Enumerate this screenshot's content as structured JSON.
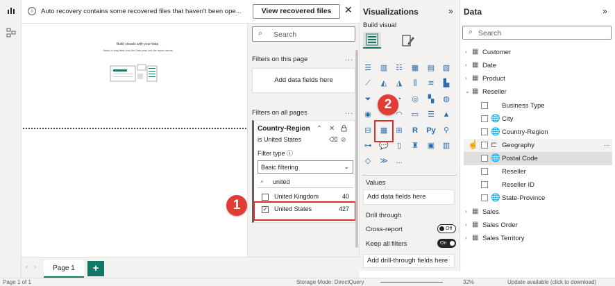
{
  "banner": {
    "message": "Auto recovery contains some recovered files that haven't been ope...",
    "button": "View recovered files",
    "close_icon": "close-icon"
  },
  "canvas": {
    "title": "Build visuals with your data",
    "subtitle": "Select or drag fields from the Data pane onto the report canvas."
  },
  "pages": {
    "tab": "Page 1",
    "add": "+"
  },
  "filters": {
    "search_placeholder": "Search",
    "on_this_page": "Filters on this page",
    "add_fields": "Add data fields here",
    "on_all_pages": "Filters on all pages",
    "card": {
      "title": "Country-Region",
      "subtitle": "is United States",
      "filter_type_label": "Filter type",
      "filter_type_value": "Basic filtering",
      "search_value": "united",
      "options": [
        {
          "label": "United Kingdom",
          "count": "40",
          "checked": false
        },
        {
          "label": "United States",
          "count": "427",
          "checked": true
        }
      ]
    }
  },
  "callouts": {
    "one": "1",
    "two": "2"
  },
  "viz": {
    "title": "Visualizations",
    "build_visual": "Build visual",
    "values_label": "Values",
    "values_add": "Add data fields here",
    "drill_through": "Drill through",
    "cross_report": "Cross-report",
    "cross_report_state": "Off",
    "keep_filters": "Keep all filters",
    "keep_filters_state": "On",
    "drill_add": "Add drill-through fields here",
    "more": "..."
  },
  "data_pane": {
    "title": "Data",
    "search_placeholder": "Search",
    "tables": [
      {
        "label": "Customer",
        "expanded": false
      },
      {
        "label": "Date",
        "expanded": false
      },
      {
        "label": "Product",
        "expanded": false
      },
      {
        "label": "Reseller",
        "expanded": true
      }
    ],
    "reseller_fields": [
      {
        "label": "Business Type",
        "kind": "field"
      },
      {
        "label": "City",
        "kind": "geo"
      },
      {
        "label": "Country-Region",
        "kind": "geo"
      },
      {
        "label": "Geography",
        "kind": "hierarchy"
      },
      {
        "label": "Postal Code",
        "kind": "geo"
      },
      {
        "label": "Reseller",
        "kind": "field"
      },
      {
        "label": "Reseller ID",
        "kind": "field"
      },
      {
        "label": "State-Province",
        "kind": "geo"
      }
    ],
    "tables_after": [
      {
        "label": "Sales"
      },
      {
        "label": "Sales Order"
      },
      {
        "label": "Sales Territory"
      }
    ]
  },
  "status": {
    "page": "Page 1 of 1",
    "storage": "Storage Mode: DirectQuery",
    "zoom": "32%",
    "update": "Update available (click to download)"
  },
  "colors": {
    "accent": "#117865",
    "callout": "#e23c35",
    "highlight": "#d9302c"
  }
}
